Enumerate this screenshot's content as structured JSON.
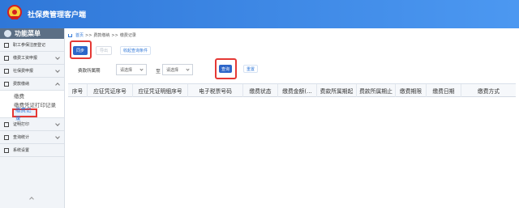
{
  "app": {
    "title": "社保费管理客户端"
  },
  "sidebar": {
    "title": "功能菜单",
    "items": [
      {
        "label": "职工参保注册登记"
      },
      {
        "label": "缴费工资申报"
      },
      {
        "label": "社保费申报"
      },
      {
        "label": "费款缴纳"
      },
      {
        "label": "证明打印"
      },
      {
        "label": "查询统计"
      },
      {
        "label": "系统设置"
      }
    ],
    "subitems": [
      {
        "label": "缴费"
      },
      {
        "label": "缴费凭证打印记录"
      },
      {
        "label": "缴费记录"
      }
    ]
  },
  "breadcrumb": {
    "home": "首页",
    "sep1": ">>",
    "middle": "费款缴纳",
    "sep2": ">>",
    "current": "缴费记录"
  },
  "toolbar": {
    "sync": "同步",
    "export": "导出",
    "save_query": "收起查询条件"
  },
  "query": {
    "label": "费款所属期",
    "from_placeholder": "请选择",
    "to_label": "至",
    "to_placeholder": "请选择",
    "search": "查询",
    "reset": "重置"
  },
  "table": {
    "columns": [
      "序号",
      "应征凭证序号",
      "应征凭证明细序号",
      "电子税票号码",
      "缴费状态",
      "缴费金额(…",
      "费款所属期起",
      "费款所属期止",
      "缴费期限",
      "缴费日期",
      "缴费方式"
    ]
  },
  "colors": {
    "header_blue": "#3b87e8",
    "button_blue": "#2d66c9",
    "highlight_red": "#e53935"
  }
}
